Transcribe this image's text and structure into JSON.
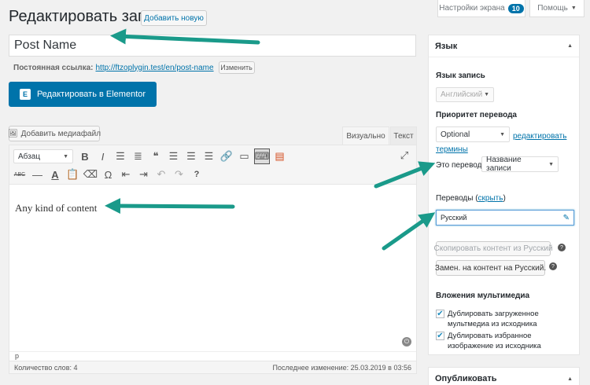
{
  "header": {
    "title": "Редактировать запись",
    "add_new": "Добавить новую",
    "screen_options": "Настройки экрана",
    "screen_options_count": "10",
    "help": "Помощь"
  },
  "post": {
    "title_value": "Post Name",
    "permalink_label": "Постоянная ссылка:",
    "permalink_url": "http://ftzoplygin.test/en/post-name",
    "permalink_change": "Изменить",
    "elementor_button": "Редактировать в Elementor",
    "elementor_icon_glyph": "E"
  },
  "editor": {
    "add_media": "Добавить медиафайл",
    "tab_visual": "Визуально",
    "tab_text": "Текст",
    "paragraph_select": "Абзац",
    "content": "Any kind of content",
    "path": "p",
    "word_count": "Количество слов: 4",
    "last_modified": "Последнее изменение: 25.03.2019 в 03:56",
    "toolbar_row1": [
      {
        "name": "bold-icon",
        "glyph": "B"
      },
      {
        "name": "italic-icon",
        "glyph": "I"
      },
      {
        "name": "bullet-list-icon",
        "glyph": "☰"
      },
      {
        "name": "numbered-list-icon",
        "glyph": "≣"
      },
      {
        "name": "blockquote-icon",
        "glyph": "❝"
      },
      {
        "name": "align-left-icon",
        "glyph": "☰"
      },
      {
        "name": "align-center-icon",
        "glyph": "☰"
      },
      {
        "name": "align-right-icon",
        "glyph": "☰"
      },
      {
        "name": "link-icon",
        "glyph": "🔗"
      },
      {
        "name": "read-more-icon",
        "glyph": "▭"
      },
      {
        "name": "toolbar-toggle-icon",
        "glyph": "⌨"
      },
      {
        "name": "comment-icon",
        "glyph": "▤"
      }
    ],
    "toolbar_row2": [
      {
        "name": "strikethrough-icon",
        "glyph": "ABC"
      },
      {
        "name": "horizontal-line-icon",
        "glyph": "—"
      },
      {
        "name": "text-color-icon",
        "glyph": "A"
      },
      {
        "name": "paste-text-icon",
        "glyph": "📋"
      },
      {
        "name": "clear-formatting-icon",
        "glyph": "⌫"
      },
      {
        "name": "special-character-icon",
        "glyph": "Ω"
      },
      {
        "name": "outdent-icon",
        "glyph": "⇤"
      },
      {
        "name": "indent-icon",
        "glyph": "⇥"
      },
      {
        "name": "undo-icon",
        "glyph": "↶"
      },
      {
        "name": "redo-icon",
        "glyph": "↷"
      },
      {
        "name": "help-icon",
        "glyph": "?"
      }
    ]
  },
  "language_box": {
    "title": "Язык",
    "language_label": "Язык запись",
    "language_value": "Английский",
    "priority_label": "Приоритет перевода",
    "priority_value": "Optional",
    "edit_terms": "редактировать термины",
    "this_translation_label": "Это перевод",
    "this_translation_value": "Название записи",
    "translations_label": "Переводы",
    "translations_hide": "скрыть",
    "translation_lang": "Русский",
    "copy_button": "Скопировать контент из Русский",
    "replace_button": "Замен. на контент на Русский.",
    "media_title": "Вложения мультимедиа",
    "dup_uploaded": "Дублировать загруженное мультмедиа из исходника",
    "dup_featured": "Дублировать избранное изображение из исходника"
  },
  "publish_box": {
    "title": "Опубликовать"
  },
  "colors": {
    "accent": "#0073aa",
    "arrow": "#1a9a8a",
    "elementor_button": "#0073aa"
  }
}
